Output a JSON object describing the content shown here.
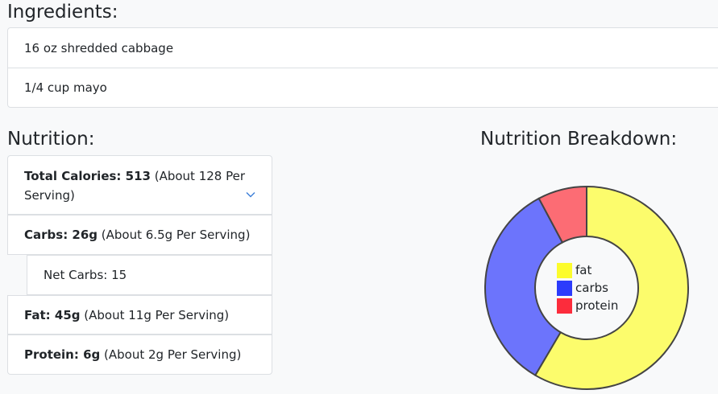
{
  "ingredients": {
    "title": "Ingredients:",
    "items": [
      "16 oz shredded cabbage",
      "1/4 cup mayo"
    ]
  },
  "nutrition": {
    "title": "Nutrition:",
    "calories": {
      "label": "Total Calories: 513",
      "detail": " (About 128 Per Serving)"
    },
    "carbs": {
      "label": "Carbs: 26g",
      "detail": " (About 6.5g Per Serving)"
    },
    "net_carbs": "Net Carbs: 15",
    "fat": {
      "label": "Fat: 45g",
      "detail": " (About 11g Per Serving)"
    },
    "protein": {
      "label": "Protein: 6g",
      "detail": " (About 2g Per Serving)"
    }
  },
  "breakdown": {
    "title": "Nutrition Breakdown:"
  },
  "chart_data": {
    "type": "pie",
    "categories": [
      "fat",
      "carbs",
      "protein"
    ],
    "values": [
      45,
      26,
      6
    ],
    "colors": [
      "#fcfc6c",
      "#6c74fc",
      "#fc6c74"
    ],
    "legend_colors": [
      "#fcfc2c",
      "#2c3cfc",
      "#fc2c3c"
    ],
    "donut": true,
    "legend": "center"
  }
}
